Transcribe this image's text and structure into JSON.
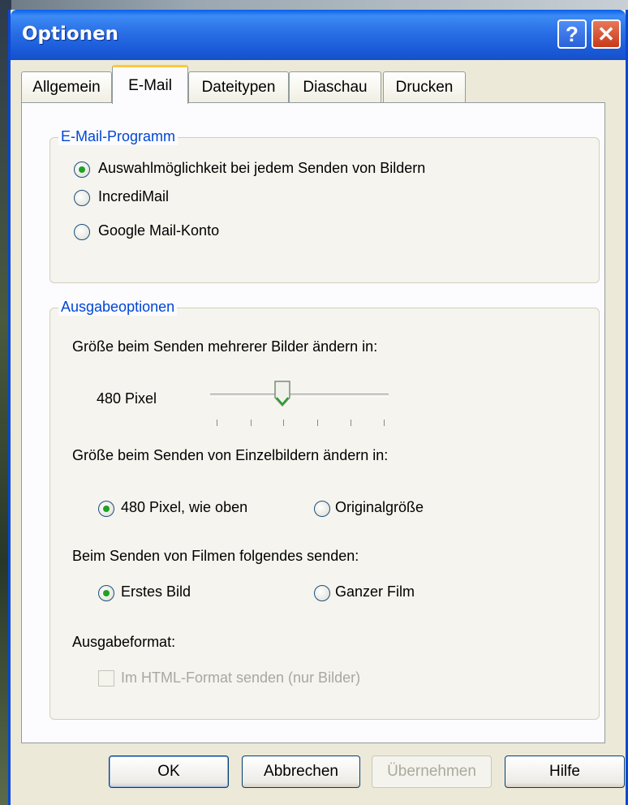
{
  "window": {
    "title": "Optionen",
    "help_glyph": "?",
    "close_glyph": "✕"
  },
  "tabs": [
    "Allgemein",
    "E-Mail",
    "Dateitypen",
    "Diaschau",
    "Drucken"
  ],
  "active_tab": "E-Mail",
  "email_program": {
    "title": "E-Mail-Programm",
    "options": [
      {
        "label": "Auswahlmöglichkeit bei jedem Senden von Bildern",
        "checked": true
      },
      {
        "label": "IncrediMail",
        "checked": false
      },
      {
        "label": "Google Mail-Konto",
        "checked": false
      }
    ]
  },
  "output_options": {
    "title": "Ausgabeoptionen",
    "multi_resize_label": "Größe beim Senden mehrerer Bilder ändern in:",
    "slider_value_label": "480 Pixel",
    "slider": {
      "ticks": 6,
      "selected_tick_index": 2
    },
    "single_resize_label": "Größe beim Senden von Einzelbildern ändern in:",
    "single_options": [
      {
        "label": "480 Pixel, wie oben",
        "checked": true
      },
      {
        "label": "Originalgröße",
        "checked": false
      }
    ],
    "movies_label": "Beim Senden von Filmen folgendes senden:",
    "movie_options": [
      {
        "label": "Erstes Bild",
        "checked": true
      },
      {
        "label": "Ganzer Film",
        "checked": false
      }
    ],
    "format_label": "Ausgabeformat:",
    "html_checkbox_label": "Im HTML-Format senden (nur Bilder)",
    "html_checkbox_checked": false,
    "html_checkbox_enabled": false
  },
  "buttons": {
    "ok": "OK",
    "cancel": "Abbrechen",
    "apply": "Übernehmen",
    "help": "Hilfe"
  }
}
